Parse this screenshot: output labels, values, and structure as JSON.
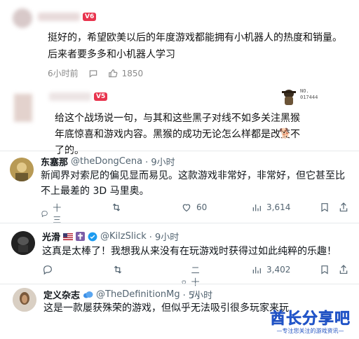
{
  "comment1": {
    "level_badge": "V6",
    "text": "挺好的，希望欧美以后的年度游戏都能拥有小机器人的热度和销量。后来者要多多和小机器人学习",
    "time": "6小时前",
    "likes": "1850"
  },
  "comment2": {
    "level_badge": "V5",
    "medal_no": "NO.\n017444",
    "text": "给这个战场说一句，与其和这些黑子对线不如多关注黑猴年底惊喜和游戏内容。黑猴的成功无论怎么样都是改变不了的。"
  },
  "tweets": [
    {
      "name": "东塞那",
      "handle": "@theDongCena",
      "time": "· 9小时",
      "text": "新闻界对索尼的偏见显而易见。这款游戏非常好，非常好，但它甚至比不上最差的 3D 马里奥。",
      "replies": "十三",
      "retweets": "",
      "likes": "60",
      "views": "3,614"
    },
    {
      "name": "光滑",
      "handle": "@KilzSlick",
      "time": "· 9小时",
      "text": "这真是太棒了！我想我从来没有在玩游戏时获得过如此纯粹的乐趣！",
      "replies": "",
      "retweets": "",
      "likes": "二十八",
      "views": "3,402"
    },
    {
      "name": "定义杂志",
      "handle": "@TheDefinitionMg",
      "time": "· 5小时",
      "text": "这是一款屡获殊荣的游戏，但似乎无法吸引很多玩家来玩"
    }
  ],
  "watermark": {
    "main": "酋长分享吧",
    "sub": "—专注您关注的游戏资讯—"
  },
  "colors": {
    "link_blue": "#1d9bf0",
    "level_red": "#e8344e",
    "watermark_blue": "#2f6df2"
  }
}
